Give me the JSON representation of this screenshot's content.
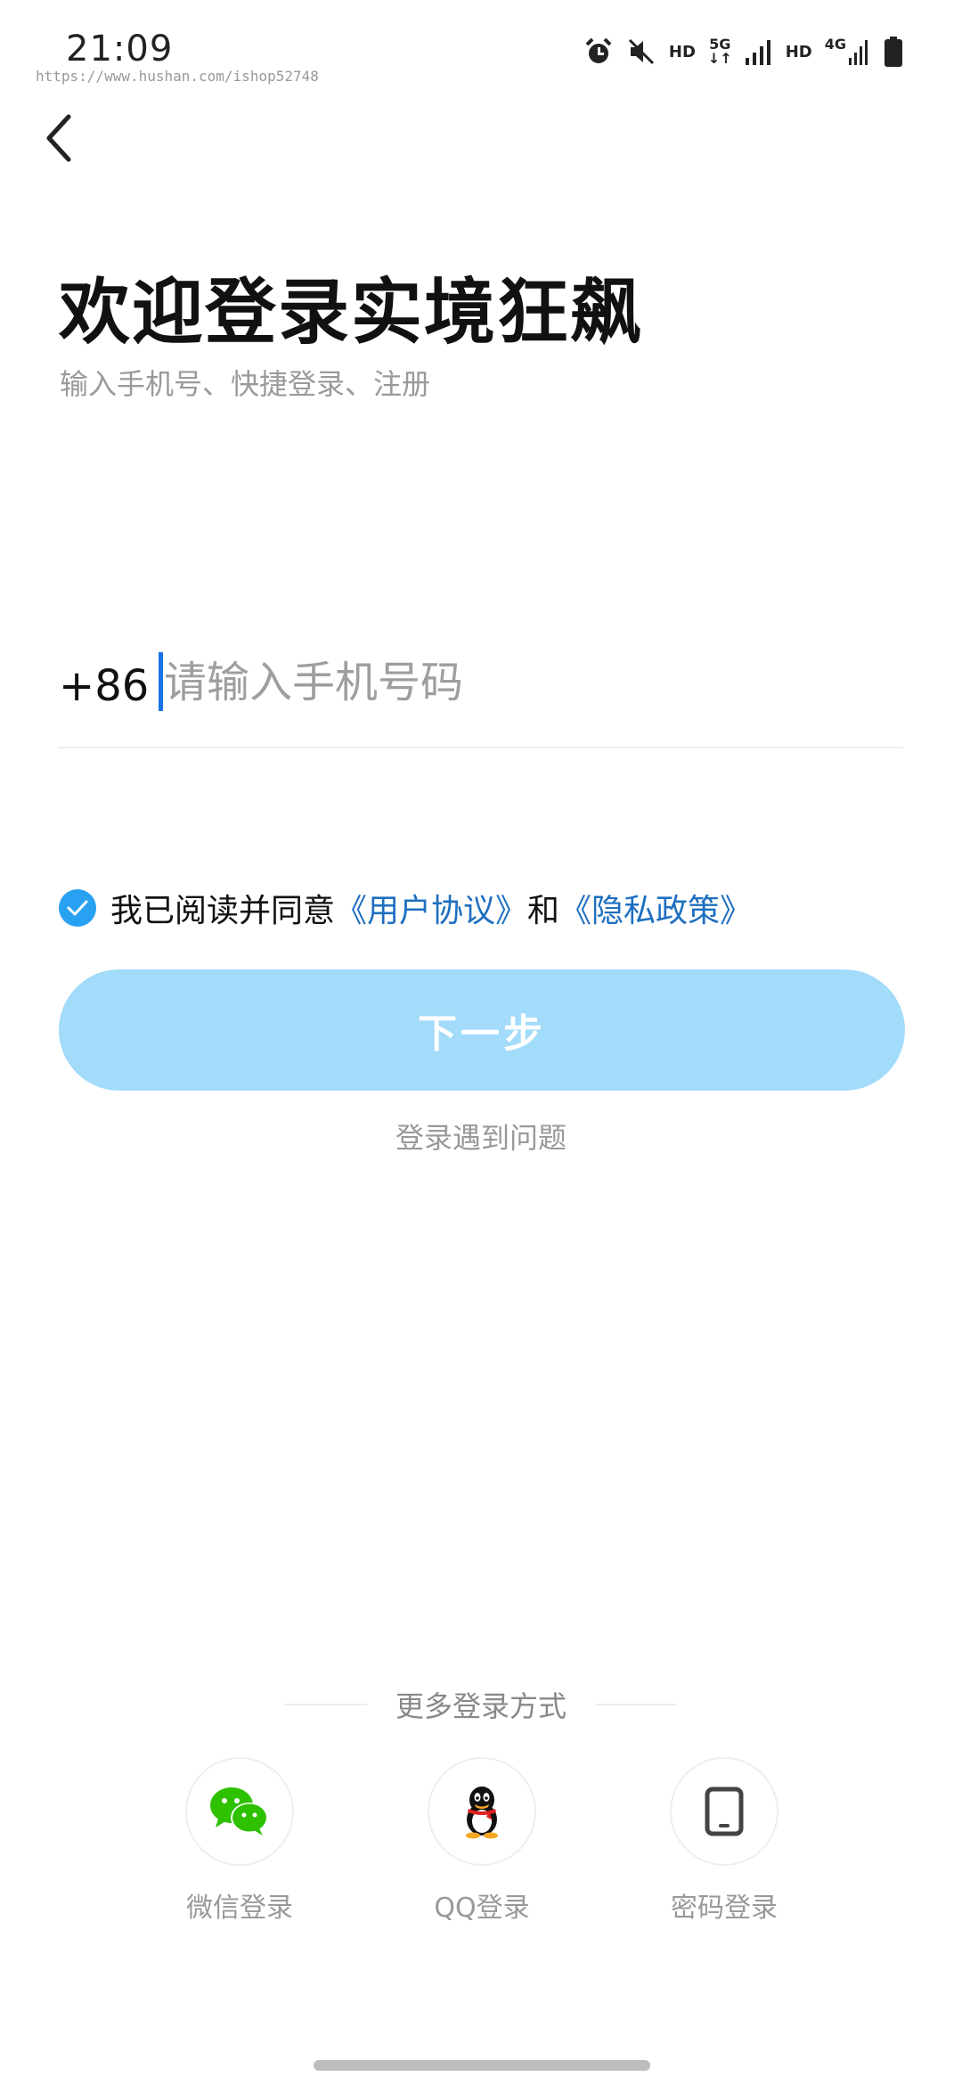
{
  "status_bar": {
    "time": "21:09",
    "watermark": "https://www.hushan.com/ishop52748",
    "icons": [
      "alarm-icon",
      "mute-icon",
      "hd-icon",
      "5g-icon",
      "signal-icon",
      "hd-icon",
      "4g-signal-icon",
      "battery-icon"
    ],
    "hd_label": "HD",
    "net_5g": "5G",
    "net_4g": "4G"
  },
  "header": {
    "back_icon": "chevron-left-icon",
    "title": "欢迎登录实境狂飙",
    "subtitle": "输入手机号、快捷登录、注册"
  },
  "phone": {
    "country_code": "+86",
    "placeholder": "请输入手机号码",
    "value": ""
  },
  "agreement": {
    "checked": true,
    "text": "我已阅读并同意",
    "user_agreement": "《用户协议》",
    "conjunction": "和",
    "privacy_policy": "《隐私政策》"
  },
  "actions": {
    "next_label": "下一步",
    "trouble_label": "登录遇到问题"
  },
  "more_login": {
    "title": "更多登录方式",
    "options": [
      {
        "label": "微信登录",
        "icon": "wechat-icon"
      },
      {
        "label": "QQ登录",
        "icon": "qq-icon"
      },
      {
        "label": "密码登录",
        "icon": "phone-device-icon"
      }
    ]
  },
  "colors": {
    "accent": "#29a1f3",
    "button_disabled": "#a3dbfa",
    "link": "#1e6fc0",
    "wechat": "#2dc100",
    "muted_text": "#999999"
  }
}
